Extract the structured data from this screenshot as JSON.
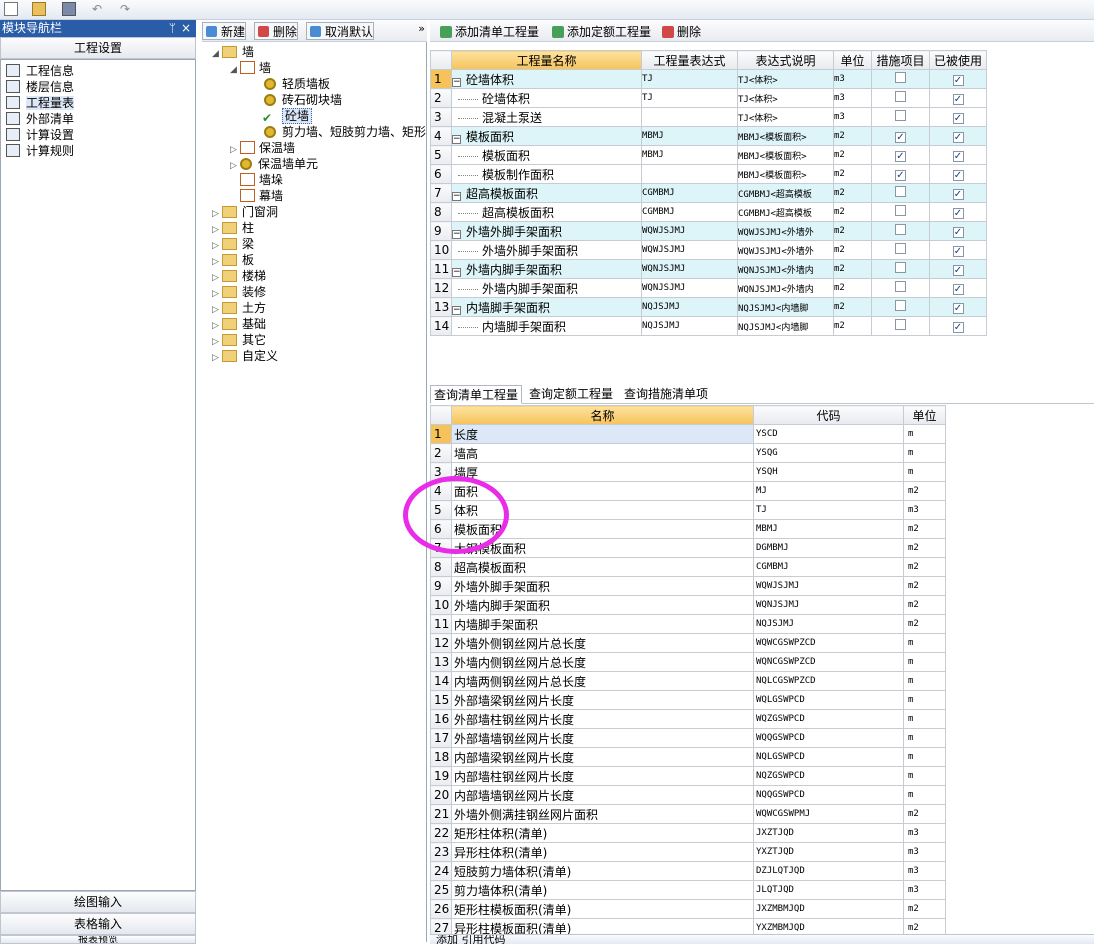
{
  "nav": {
    "header": "模块导航栏",
    "section": "工程设置",
    "items": [
      "工程信息",
      "楼层信息",
      "工程量表",
      "外部清单",
      "计算设置",
      "计算规则"
    ],
    "bottom": [
      "绘图输入",
      "表格输入",
      "报表预览"
    ]
  },
  "mid_toolbar": {
    "new": "新建",
    "delete": "删除",
    "cancel_default": "取消默认"
  },
  "tree": {
    "wall": "墙",
    "wall_child": "墙",
    "light_wall": "轻质墙板",
    "brick_wall": "砖石砌块墙",
    "concrete_wall": "砼墙",
    "shear_wall": "剪力墙、短肢剪力墙、矩形",
    "insul_wall": "保温墙",
    "insul_unit": "保温墙单元",
    "wall_pier": "墙垛",
    "curtain_wall": "幕墙",
    "others": [
      "门窗洞",
      "柱",
      "梁",
      "板",
      "楼梯",
      "装修",
      "土方",
      "基础",
      "其它",
      "自定义"
    ]
  },
  "right_toolbar": {
    "add_list": "添加清单工程量",
    "add_quota": "添加定额工程量",
    "delete": "删除"
  },
  "grid1": {
    "headers": [
      "工程量名称",
      "工程量表达式",
      "表达式说明",
      "单位",
      "措施项目",
      "已被使用"
    ],
    "rows": [
      {
        "n": "1",
        "name": "砼墙体积",
        "expr": "TJ",
        "desc": "TJ<体积>",
        "unit": "m3",
        "measure": false,
        "used": true,
        "group": true
      },
      {
        "n": "2",
        "name": "砼墙体积",
        "expr": "TJ",
        "desc": "TJ<体积>",
        "unit": "m3",
        "measure": false,
        "used": true,
        "group": false
      },
      {
        "n": "3",
        "name": "混凝土泵送",
        "expr": "",
        "desc": "TJ<体积>",
        "unit": "m3",
        "measure": false,
        "used": true,
        "group": false
      },
      {
        "n": "4",
        "name": "模板面积",
        "expr": "MBMJ",
        "desc": "MBMJ<模板面积>",
        "unit": "m2",
        "measure": true,
        "used": true,
        "group": true
      },
      {
        "n": "5",
        "name": "模板面积",
        "expr": "MBMJ",
        "desc": "MBMJ<模板面积>",
        "unit": "m2",
        "measure": true,
        "used": true,
        "group": false
      },
      {
        "n": "6",
        "name": "模板制作面积",
        "expr": "",
        "desc": "MBMJ<模板面积>",
        "unit": "m2",
        "measure": true,
        "used": true,
        "group": false
      },
      {
        "n": "7",
        "name": "超高模板面积",
        "expr": "CGMBMJ",
        "desc": "CGMBMJ<超高模板",
        "unit": "m2",
        "measure": false,
        "used": true,
        "group": true
      },
      {
        "n": "8",
        "name": "超高模板面积",
        "expr": "CGMBMJ",
        "desc": "CGMBMJ<超高模板",
        "unit": "m2",
        "measure": false,
        "used": true,
        "group": false
      },
      {
        "n": "9",
        "name": "外墙外脚手架面积",
        "expr": "WQWJSJMJ",
        "desc": "WQWJSJMJ<外墙外",
        "unit": "m2",
        "measure": false,
        "used": true,
        "group": true
      },
      {
        "n": "10",
        "name": "外墙外脚手架面积",
        "expr": "WQWJSJMJ",
        "desc": "WQWJSJMJ<外墙外",
        "unit": "m2",
        "measure": false,
        "used": true,
        "group": false
      },
      {
        "n": "11",
        "name": "外墙内脚手架面积",
        "expr": "WQNJSJMJ",
        "desc": "WQNJSJMJ<外墙内",
        "unit": "m2",
        "measure": false,
        "used": true,
        "group": true
      },
      {
        "n": "12",
        "name": "外墙内脚手架面积",
        "expr": "WQNJSJMJ",
        "desc": "WQNJSJMJ<外墙内",
        "unit": "m2",
        "measure": false,
        "used": true,
        "group": false
      },
      {
        "n": "13",
        "name": "内墙脚手架面积",
        "expr": "NQJSJMJ",
        "desc": "NQJSJMJ<内墙脚",
        "unit": "m2",
        "measure": false,
        "used": true,
        "group": true
      },
      {
        "n": "14",
        "name": "内墙脚手架面积",
        "expr": "NQJSJMJ",
        "desc": "NQJSJMJ<内墙脚",
        "unit": "m2",
        "measure": false,
        "used": true,
        "group": false
      }
    ]
  },
  "tabs": [
    "查询清单工程量",
    "查询定额工程量",
    "查询措施清单项"
  ],
  "grid2": {
    "headers": [
      "名称",
      "代码",
      "单位"
    ],
    "rows": [
      [
        "1",
        "长度",
        "YSCD",
        "m"
      ],
      [
        "2",
        "墙高",
        "YSQG",
        "m"
      ],
      [
        "3",
        "墙厚",
        "YSQH",
        "m"
      ],
      [
        "4",
        "面积",
        "MJ",
        "m2"
      ],
      [
        "5",
        "体积",
        "TJ",
        "m3"
      ],
      [
        "6",
        "模板面积",
        "MBMJ",
        "m2"
      ],
      [
        "7",
        "大钢模板面积",
        "DGMBMJ",
        "m2"
      ],
      [
        "8",
        "超高模板面积",
        "CGMBMJ",
        "m2"
      ],
      [
        "9",
        "外墙外脚手架面积",
        "WQWJSJMJ",
        "m2"
      ],
      [
        "10",
        "外墙内脚手架面积",
        "WQNJSJMJ",
        "m2"
      ],
      [
        "11",
        "内墙脚手架面积",
        "NQJSJMJ",
        "m2"
      ],
      [
        "12",
        "外墙外侧钢丝网片总长度",
        "WQWCGSWPZCD",
        "m"
      ],
      [
        "13",
        "外墙内侧钢丝网片总长度",
        "WQNCGSWPZCD",
        "m"
      ],
      [
        "14",
        "内墙两侧钢丝网片总长度",
        "NQLCGSWPZCD",
        "m"
      ],
      [
        "15",
        "外部墙梁钢丝网片长度",
        "WQLGSWPCD",
        "m"
      ],
      [
        "16",
        "外部墙柱钢丝网片长度",
        "WQZGSWPCD",
        "m"
      ],
      [
        "17",
        "外部墙墙钢丝网片长度",
        "WQQGSWPCD",
        "m"
      ],
      [
        "18",
        "内部墙梁钢丝网片长度",
        "NQLGSWPCD",
        "m"
      ],
      [
        "19",
        "内部墙柱钢丝网片长度",
        "NQZGSWPCD",
        "m"
      ],
      [
        "20",
        "内部墙墙钢丝网片长度",
        "NQQGSWPCD",
        "m"
      ],
      [
        "21",
        "外墙外侧满挂钢丝网片面积",
        "WQWCGSWPMJ",
        "m2"
      ],
      [
        "22",
        "矩形柱体积(清单)",
        "JXZTJQD",
        "m3"
      ],
      [
        "23",
        "异形柱体积(清单)",
        "YXZTJQD",
        "m3"
      ],
      [
        "24",
        "短肢剪力墙体积(清单)",
        "DZJLQTJQD",
        "m3"
      ],
      [
        "25",
        "剪力墙体积(清单)",
        "JLQTJQD",
        "m3"
      ],
      [
        "26",
        "矩形柱模板面积(清单)",
        "JXZMBMJQD",
        "m2"
      ],
      [
        "27",
        "异形柱模板面积(清单)",
        "YXZMBMJQD",
        "m2"
      ]
    ]
  },
  "bottom_bar": "添加 引用代码",
  "accent": "#e82ce8"
}
